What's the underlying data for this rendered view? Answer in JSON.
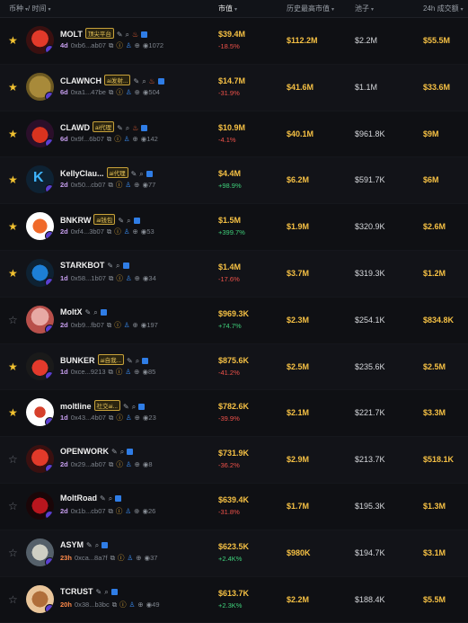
{
  "header": {
    "coin": "币种",
    "time": "/ 时间",
    "mcap": "市值",
    "ath": "历史最高市值",
    "pool": "池子",
    "vol": "24h 成交额",
    "sort_icon": "▾"
  },
  "rows": [
    {
      "starred": true,
      "avatar": "red-robot-icon",
      "name": "MOLT",
      "tag": "顶尖平台",
      "age": "4d",
      "addr": "0xb6...ab07",
      "views": "1072",
      "mcap": "$39.4M",
      "change": "-18.5%",
      "ath": "$112.2M",
      "pool": "$2.2M",
      "vol": "$55.5M"
    },
    {
      "starred": true,
      "avatar": "gold-coin-icon",
      "name": "CLAWNCH",
      "tag": "ai发射...",
      "age": "6d",
      "addr": "0xa1...47be",
      "views": "504",
      "mcap": "$14.7M",
      "change": "-31.9%",
      "ath": "$41.6M",
      "pool": "$1.1M",
      "vol": "$33.6M"
    },
    {
      "starred": true,
      "avatar": "red-crab-icon",
      "name": "CLAWD",
      "tag": "ai代理",
      "age": "6d",
      "addr": "0x9f...6b07",
      "views": "142",
      "mcap": "$10.9M",
      "change": "-4.1%",
      "ath": "$40.1M",
      "pool": "$961.8K",
      "vol": "$9M"
    },
    {
      "starred": true,
      "avatar": "k-logo-icon",
      "name": "KellyClau...",
      "tag": "ai代理",
      "age": "2d",
      "addr": "0x50...cb07",
      "views": "77",
      "mcap": "$4.4M",
      "change": "+98.9%",
      "ath": "$6.2M",
      "pool": "$591.7K",
      "vol": "$6M"
    },
    {
      "starred": true,
      "avatar": "orange-tv-icon",
      "name": "BNKRW",
      "tag": "ai钱包",
      "age": "2d",
      "addr": "0xf4...3b07",
      "views": "53",
      "mcap": "$1.5M",
      "change": "+399.7%",
      "ath": "$1.9M",
      "pool": "$320.9K",
      "vol": "$2.6M"
    },
    {
      "starred": true,
      "avatar": "blue-bot-icon",
      "name": "STARKBOT",
      "tag": "",
      "age": "1d",
      "addr": "0x58...1b07",
      "views": "34",
      "mcap": "$1.4M",
      "change": "-17.6%",
      "ath": "$3.7M",
      "pool": "$319.3K",
      "vol": "$1.2M"
    },
    {
      "starred": false,
      "avatar": "pink-figure-icon",
      "name": "MoltX",
      "tag": "",
      "age": "2d",
      "addr": "0xb9...fb07",
      "views": "197",
      "mcap": "$969.3K",
      "change": "+74.7%",
      "ath": "$2.3M",
      "pool": "$254.1K",
      "vol": "$834.8K"
    },
    {
      "starred": true,
      "avatar": "raccoon-icon",
      "name": "BUNKER",
      "tag": "ai自我...",
      "age": "1d",
      "addr": "0xce...9213",
      "views": "85",
      "mcap": "$875.6K",
      "change": "-41.2%",
      "ath": "$2.5M",
      "pool": "$235.6K",
      "vol": "$2.5M"
    },
    {
      "starred": true,
      "avatar": "fox-icon",
      "name": "moltline",
      "tag": "社交ai...",
      "age": "1d",
      "addr": "0x43...4b07",
      "views": "23",
      "mcap": "$782.6K",
      "change": "-39.9%",
      "ath": "$2.1M",
      "pool": "$221.7K",
      "vol": "$3.3M"
    },
    {
      "starred": false,
      "avatar": "red-robot-icon",
      "name": "OPENWORK",
      "tag": "",
      "age": "2d",
      "addr": "0x29...ab07",
      "views": "8",
      "mcap": "$731.9K",
      "change": "-36.2%",
      "ath": "$2.9M",
      "pool": "$213.7K",
      "vol": "$518.1K"
    },
    {
      "starred": false,
      "avatar": "red-demon-icon",
      "name": "MoltRoad",
      "tag": "",
      "age": "2d",
      "addr": "0x1b...cb07",
      "views": "26",
      "mcap": "$639.4K",
      "change": "-31.8%",
      "ath": "$1.7M",
      "pool": "$195.3K",
      "vol": "$1.3M"
    },
    {
      "starred": false,
      "avatar": "cat-icon",
      "name": "ASYM",
      "tag": "",
      "age": "23h",
      "addr": "0xca...8a7f",
      "views": "37",
      "mcap": "$623.5K",
      "change": "+2.4K%",
      "ath": "$980K",
      "pool": "$194.7K",
      "vol": "$3.1M"
    },
    {
      "starred": false,
      "avatar": "crab-figure-icon",
      "name": "TCRUST",
      "tag": "",
      "age": "20h",
      "addr": "0x38...b3bc",
      "views": "49",
      "mcap": "$613.7K",
      "change": "+2.3K%",
      "ath": "$2.2M",
      "pool": "$188.4K",
      "vol": "$5.5M"
    }
  ]
}
